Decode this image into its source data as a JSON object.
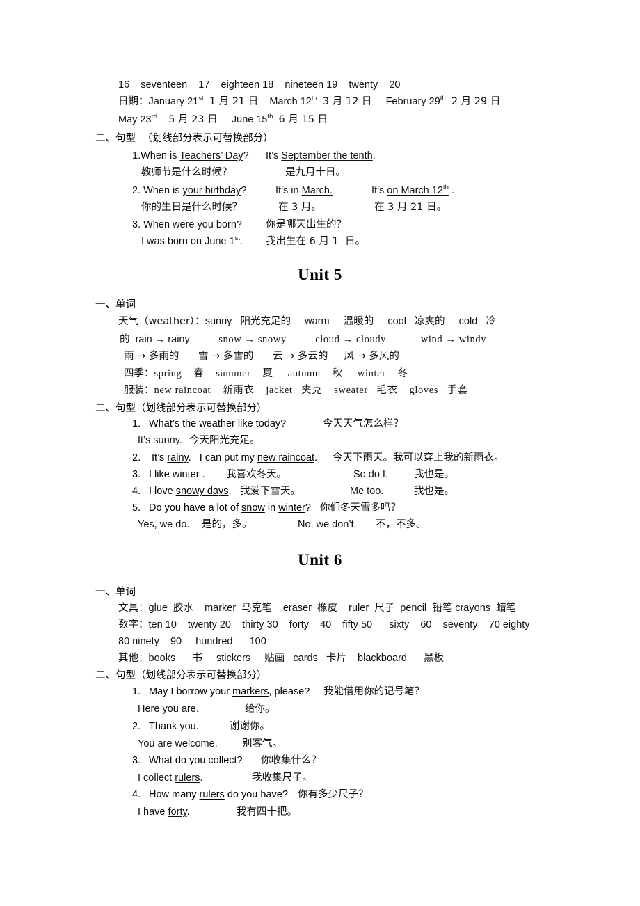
{
  "document": {
    "type": "study-notes",
    "language": "en-zh",
    "page_background": "#ffffff",
    "text_color": "#111111"
  },
  "unit4_tail": {
    "numbers_line": "16    seventeen    17    eighteen 18    nineteen 19    twenty    20",
    "dates_label": "日期：",
    "dates_line1_a": "January 21",
    "dates_line1_a_sup": "st",
    "dates_line1_a_cn": "1 月 21 日",
    "dates_line1_b": "March 12",
    "dates_line1_b_sup": "th",
    "dates_line1_b_cn": "3 月 12 日",
    "dates_line1_c": "February 29",
    "dates_line1_c_sup": "th",
    "dates_line1_c_cn": "2 月 29 日",
    "dates_line2_a": "May 23",
    "dates_line2_a_sup": "rd",
    "dates_line2_a_cn": "5 月 23 日",
    "dates_line2_b": "June 15",
    "dates_line2_b_sup": "th",
    "dates_line2_b_cn": "6 月 15 日",
    "patterns_heading": "二、句型  （划线部分表示可替换部分）",
    "p1_num": "1.",
    "p1_en_a": "When is ",
    "p1_en_a_u": "Teachers’ Day",
    "p1_en_a_tail": "?",
    "p1_en_b": "It’s ",
    "p1_en_b_u": "September the tenth",
    "p1_en_b_tail": ".",
    "p1_cn_a": "教师节是什么时候？",
    "p1_cn_b": "是九月十日。",
    "p2_num": "2.",
    "p2_en_a": "When is ",
    "p2_en_a_u": "your birthday",
    "p2_en_a_tail": "?",
    "p2_en_b": "It’s in ",
    "p2_en_b_u": "March.",
    "p2_en_c": "It’s ",
    "p2_en_c_u": "on March 12",
    "p2_en_c_sup": "th",
    "p2_en_c_tail": " .",
    "p2_cn_a": "你的生日是什么时候？",
    "p2_cn_b": "在 3 月。",
    "p2_cn_c": "在 3 月 21 日。",
    "p3_num": "3.",
    "p3_en_a": "When were you born?",
    "p3_cn_a": "你是哪天出生的？",
    "p3_en_b": "I was born on June 1",
    "p3_en_b_sup": "st",
    "p3_en_b_tail": ".",
    "p3_cn_b": "我出生在 6 月 1  日。"
  },
  "unit5": {
    "title": "Unit 5",
    "vocab_heading": "一、单词",
    "weather_label": "天气（weather）：",
    "weather_pairs": "sunny   阳光充足的     warm     温暖的     cool   凉爽的     cold   冷",
    "weather_cont": "的",
    "derive_en_1": "rain → rainy",
    "derive_en_2": "snow → snowy",
    "derive_en_3": "cloud → cloudy",
    "derive_en_4": "wind → windy",
    "derive_cn_1": "雨 → 多雨的",
    "derive_cn_2": "雪 → 多雪的",
    "derive_cn_3": "云 → 多云的",
    "derive_cn_4": "风 → 多风的",
    "seasons_label": "四季：",
    "seasons": "spring    春    summer    夏     autumn    秋     winter    冬",
    "clothes_label": "服装：",
    "clothes": "new raincoat    新雨衣    jacket   夹克    sweater   毛衣    gloves   手套",
    "patterns_heading": "二、句型（划线部分表示可替换部分）",
    "s1_num": "1.",
    "s1_en": "What’s the weather like today?",
    "s1_cn": "今天天气怎么样？",
    "s1b_en_a": "It’s ",
    "s1b_en_u": "sunny",
    "s1b_en_tail": ".",
    "s1b_cn": "今天阳光充足。",
    "s2_num": "2.",
    "s2_en_a": "It’s ",
    "s2_en_u1": "rainy",
    "s2_en_mid": ".   I can put my ",
    "s2_en_u2": "new raincoat",
    "s2_en_tail": ".",
    "s2_cn": "今天下雨天。我可以穿上我的新雨衣。",
    "s3_num": "3.",
    "s3_en_a": "I like ",
    "s3_en_u": "winter",
    "s3_en_tail": " .",
    "s3_cn": "我喜欢冬天。",
    "s3_en_b": "So do I.",
    "s3_cn_b": "我也是。",
    "s4_num": "4.",
    "s4_en_a": "I love ",
    "s4_en_u": "snowy days",
    "s4_en_tail": ".",
    "s4_cn": "我爱下雪天。",
    "s4_en_b": "Me too.",
    "s4_cn_b": "我也是。",
    "s5_num": "5.",
    "s5_en_a": "Do you have a lot of ",
    "s5_en_u1": "snow",
    "s5_en_mid": " in ",
    "s5_en_u2": "winter",
    "s5_en_tail": "?",
    "s5_cn": "你们冬天雪多吗？",
    "s5_en_b": "Yes, we do.",
    "s5_cn_b": "是的，多。",
    "s5_en_c": "No, we don’t.",
    "s5_cn_c": "不，不多。"
  },
  "unit6": {
    "title": "Unit 6",
    "vocab_heading": "一、单词",
    "stationery_label": "文具：",
    "stationery": "glue  胶水    marker  马克笔    eraser  橡皮    ruler  尺子  pencil  铅笔 crayons  蜡笔",
    "numbers_label": "数字：",
    "numbers_line1": "ten 10    twenty 20    thirty 30    forty    40    fifty 50      sixty    60    seventy    70 eighty",
    "numbers_line2": "80 ninety    90     hundred      100",
    "others_label": "其他：",
    "others": "books      书     stickers     贴画   cards   卡片    blackboard      黑板",
    "patterns_heading": "二、句型（划线部分表示可替换部分）",
    "t1_num": "1.",
    "t1_en_a": "May I borrow your ",
    "t1_en_u": "markers",
    "t1_en_tail": ", please?",
    "t1_cn": "我能借用你的记号笔？",
    "t1b_en": "Here you are.",
    "t1b_cn": "给你。",
    "t2_num": "2.",
    "t2_en": "Thank you.",
    "t2_cn": "谢谢你。",
    "t2b_en": "You are welcome.",
    "t2b_cn": "别客气。",
    "t3_num": "3.",
    "t3_en": "What do you collect?",
    "t3_cn": "你收集什么？",
    "t3b_en_a": "I collect ",
    "t3b_en_u": "rulers",
    "t3b_en_tail": ".",
    "t3b_cn": "我收集尺子。",
    "t4_num": "4.",
    "t4_en_a": "How many ",
    "t4_en_u": "rulers",
    "t4_en_tail": " do you have?",
    "t4_cn": "你有多少尺子？",
    "t4b_en_a": "I have ",
    "t4b_en_u": "forty",
    "t4b_en_tail": ".",
    "t4b_cn": "我有四十把。"
  }
}
